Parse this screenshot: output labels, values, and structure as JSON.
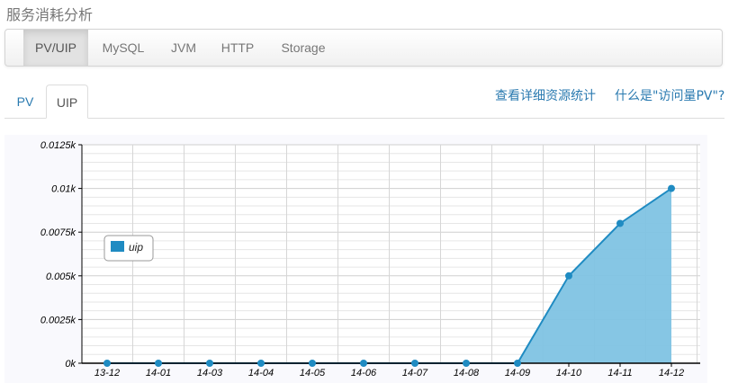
{
  "page": {
    "title": "服务消耗分析"
  },
  "navbar": {
    "items": [
      {
        "label": "PV/UIP",
        "active": true
      },
      {
        "label": "MySQL",
        "active": false
      },
      {
        "label": "JVM",
        "active": false
      },
      {
        "label": "HTTP",
        "active": false
      },
      {
        "label": "Storage",
        "active": false
      }
    ]
  },
  "tabs": [
    {
      "label": "PV",
      "active": false
    },
    {
      "label": "UIP",
      "active": true
    }
  ],
  "links": {
    "details": "查看详细资源统计",
    "what_is_pv": "什么是\"访问量PV\"?"
  },
  "colors": {
    "line": "#1f8bc2",
    "fill": "#7fc3e3",
    "link": "#2a7ab0"
  },
  "chart_data": {
    "type": "area",
    "categories": [
      "13-12",
      "14-01",
      "14-03",
      "14-04",
      "14-05",
      "14-06",
      "14-07",
      "14-08",
      "14-09",
      "14-10",
      "14-11",
      "14-12"
    ],
    "series": [
      {
        "name": "uip",
        "values": [
          0,
          0,
          0,
          0,
          0,
          0,
          0,
          0,
          0,
          0.005,
          0.008,
          0.01
        ]
      }
    ],
    "y_ticks": [
      "0k",
      "0.0025k",
      "0.005k",
      "0.0075k",
      "0.01k",
      "0.0125k"
    ],
    "ylim": [
      0,
      0.0125
    ],
    "grid": true,
    "legend_position": "left"
  }
}
